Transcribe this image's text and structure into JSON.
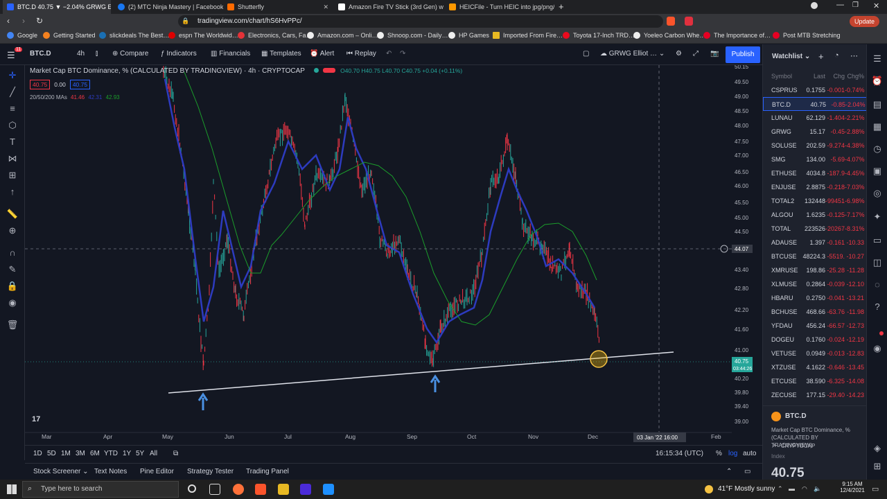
{
  "browser": {
    "tabs": [
      {
        "label": "BTC.D 40.75 ▼ −2.04% GRWG Elli…",
        "active": true,
        "color": "#2962ff"
      },
      {
        "label": "(2) MTC Ninja Mastery | Facebook",
        "active": false,
        "color": "#1877f2"
      },
      {
        "label": "Shutterfly",
        "active": false,
        "color": "#ff6a00"
      },
      {
        "label": "Amazon Fire TV Stick (3rd Gen) with A…",
        "active": false,
        "color": "#ffffff"
      },
      {
        "label": "HEICFile - Turn HEIC into jpg/png/gif…",
        "active": false,
        "color": "#ff9900"
      }
    ],
    "url": "tradingview.com/chart/hS6HvPPc/",
    "update_label": "Update",
    "bookmarks": [
      "Google",
      "Getting Started",
      "slickdeals The Best…",
      "espn The Worldwid…",
      "Electronics, Cars, Fa…",
      "Amazon.com – Onli…",
      "Shnoop.com - Daily…",
      "HP Games",
      "Imported From Fire…",
      "Toyota 17-Inch TRD…",
      "Yoeleo Carbon Whe…",
      "The Importance of…",
      "Post MTB Stretching"
    ]
  },
  "toolbar": {
    "symbol": "BTC.D",
    "interval": "4h",
    "compare": "Compare",
    "indicators": "Indicators",
    "financials": "Financials",
    "templates": "Templates",
    "alert": "Alert",
    "replay": "Replay",
    "layout_name": "GRWG Elliot …",
    "publish": "Publish",
    "notif_count": "11"
  },
  "legend": {
    "title": "Market Cap BTC Dominance, % (CALCULATED BY TRADINGVIEW)",
    "interval": "4h",
    "source": "CRYPTOCAP",
    "ohlc": "O40.70 H40.75 L40.70 C40.75 +0.04 (+0.11%)",
    "bid": "40.75",
    "spread": "0.00",
    "ask": "40.75",
    "ma_label": "20/50/200 MAs",
    "ma1": "41.46",
    "ma2": "42.31",
    "ma3": "42.93"
  },
  "price_axis": {
    "ticks": [
      "50.15",
      "49.50",
      "49.00",
      "48.50",
      "48.00",
      "47.50",
      "47.00",
      "46.50",
      "46.00",
      "45.50",
      "45.00",
      "44.50",
      "43.40",
      "42.80",
      "42.20",
      "41.60",
      "41.00",
      "40.20",
      "39.80",
      "39.40",
      "39.00"
    ],
    "crosshair_price": "44.07",
    "last_price": "40.75",
    "countdown": "03:44:26"
  },
  "time_axis": {
    "labels": [
      "Mar",
      "Apr",
      "May",
      "Jun",
      "Jul",
      "Aug",
      "Sep",
      "Oct",
      "Nov",
      "Dec",
      "Feb"
    ],
    "crosshair_time": "03 Jan '22  16:00"
  },
  "bottom": {
    "ranges": [
      "1D",
      "5D",
      "1M",
      "3M",
      "6M",
      "YTD",
      "1Y",
      "5Y",
      "All"
    ],
    "clock": "16:15:34 (UTC)",
    "percent": "%",
    "log": "log",
    "auto": "auto",
    "panels": [
      "Stock Screener",
      "Text Notes",
      "Pine Editor",
      "Strategy Tester",
      "Trading Panel"
    ]
  },
  "watchlist": {
    "title": "Watchlist",
    "headers": [
      "Symbol",
      "Last",
      "Chg",
      "Chg%"
    ],
    "rows": [
      {
        "symbol": "CSPRUS",
        "last": "0.1755",
        "chg": "-0.001",
        "pct": "-0.74%"
      },
      {
        "symbol": "BTC.D",
        "last": "40.75",
        "chg": "-0.85",
        "pct": "-2.04%"
      },
      {
        "symbol": "LUNAU",
        "last": "62.129",
        "chg": "-1.404",
        "pct": "-2.21%"
      },
      {
        "symbol": "GRWG",
        "last": "15.17",
        "chg": "-0.45",
        "pct": "-2.88%"
      },
      {
        "symbol": "SOLUSE",
        "last": "202.59",
        "chg": "-9.274",
        "pct": "-4.38%"
      },
      {
        "symbol": "SMG",
        "last": "134.00",
        "chg": "-5.69",
        "pct": "-4.07%"
      },
      {
        "symbol": "ETHUSE",
        "last": "4034.8",
        "chg": "-187.9",
        "pct": "-4.45%"
      },
      {
        "symbol": "ENJUSE",
        "last": "2.8875",
        "chg": "-0.218",
        "pct": "-7.03%"
      },
      {
        "symbol": "TOTAL2",
        "last": "132448",
        "chg": "-99451",
        "pct": "-6.98%"
      },
      {
        "symbol": "ALGOU",
        "last": "1.6235",
        "chg": "-0.125",
        "pct": "-7.17%"
      },
      {
        "symbol": "TOTAL",
        "last": "223526",
        "chg": "-20267",
        "pct": "-8.31%"
      },
      {
        "symbol": "ADAUSE",
        "last": "1.397",
        "chg": "-0.161",
        "pct": "-10.33"
      },
      {
        "symbol": "BTCUSE",
        "last": "48224.3",
        "chg": "-5519.",
        "pct": "-10.27"
      },
      {
        "symbol": "XMRUSE",
        "last": "198.86",
        "chg": "-25.28",
        "pct": "-11.28"
      },
      {
        "symbol": "XLMUSE",
        "last": "0.2864",
        "chg": "-0.039",
        "pct": "-12.10"
      },
      {
        "symbol": "HBARU",
        "last": "0.2750",
        "chg": "-0.041",
        "pct": "-13.21"
      },
      {
        "symbol": "BCHUSE",
        "last": "468.66",
        "chg": "-63.76",
        "pct": "-11.98"
      },
      {
        "symbol": "YFDAU",
        "last": "456.24",
        "chg": "-66.57",
        "pct": "-12.73"
      },
      {
        "symbol": "DOGEU",
        "last": "0.1760",
        "chg": "-0.024",
        "pct": "-12.19"
      },
      {
        "symbol": "VETUSE",
        "last": "0.0949",
        "chg": "-0.013",
        "pct": "-12.83"
      },
      {
        "symbol": "XTZUSE",
        "last": "4.1622",
        "chg": "-0.646",
        "pct": "-13.45"
      },
      {
        "symbol": "ETCUSE",
        "last": "38.590",
        "chg": "-6.325",
        "pct": "-14.08"
      },
      {
        "symbol": "ZECUSE",
        "last": "177.15",
        "chg": "-29.40",
        "pct": "-14.23"
      }
    ],
    "detail_symbol": "BTC.D",
    "detail_name": "Market Cap BTC Dominance, % (CALCULATED BY TRADINGVIEW)",
    "detail_exchange": "CRYPTOCAP",
    "detail_type": "Index",
    "detail_price": "40.75"
  },
  "taskbar": {
    "search_placeholder": "Type here to search",
    "weather": "41°F  Mostly sunny",
    "time": "9:15 AM",
    "date": "12/4/2021"
  },
  "colors": {
    "up": "#26a69a",
    "down": "#f23645",
    "accent": "#2962ff",
    "ma_green": "#1b9e2b",
    "ma_blue": "#2d3bbf"
  }
}
